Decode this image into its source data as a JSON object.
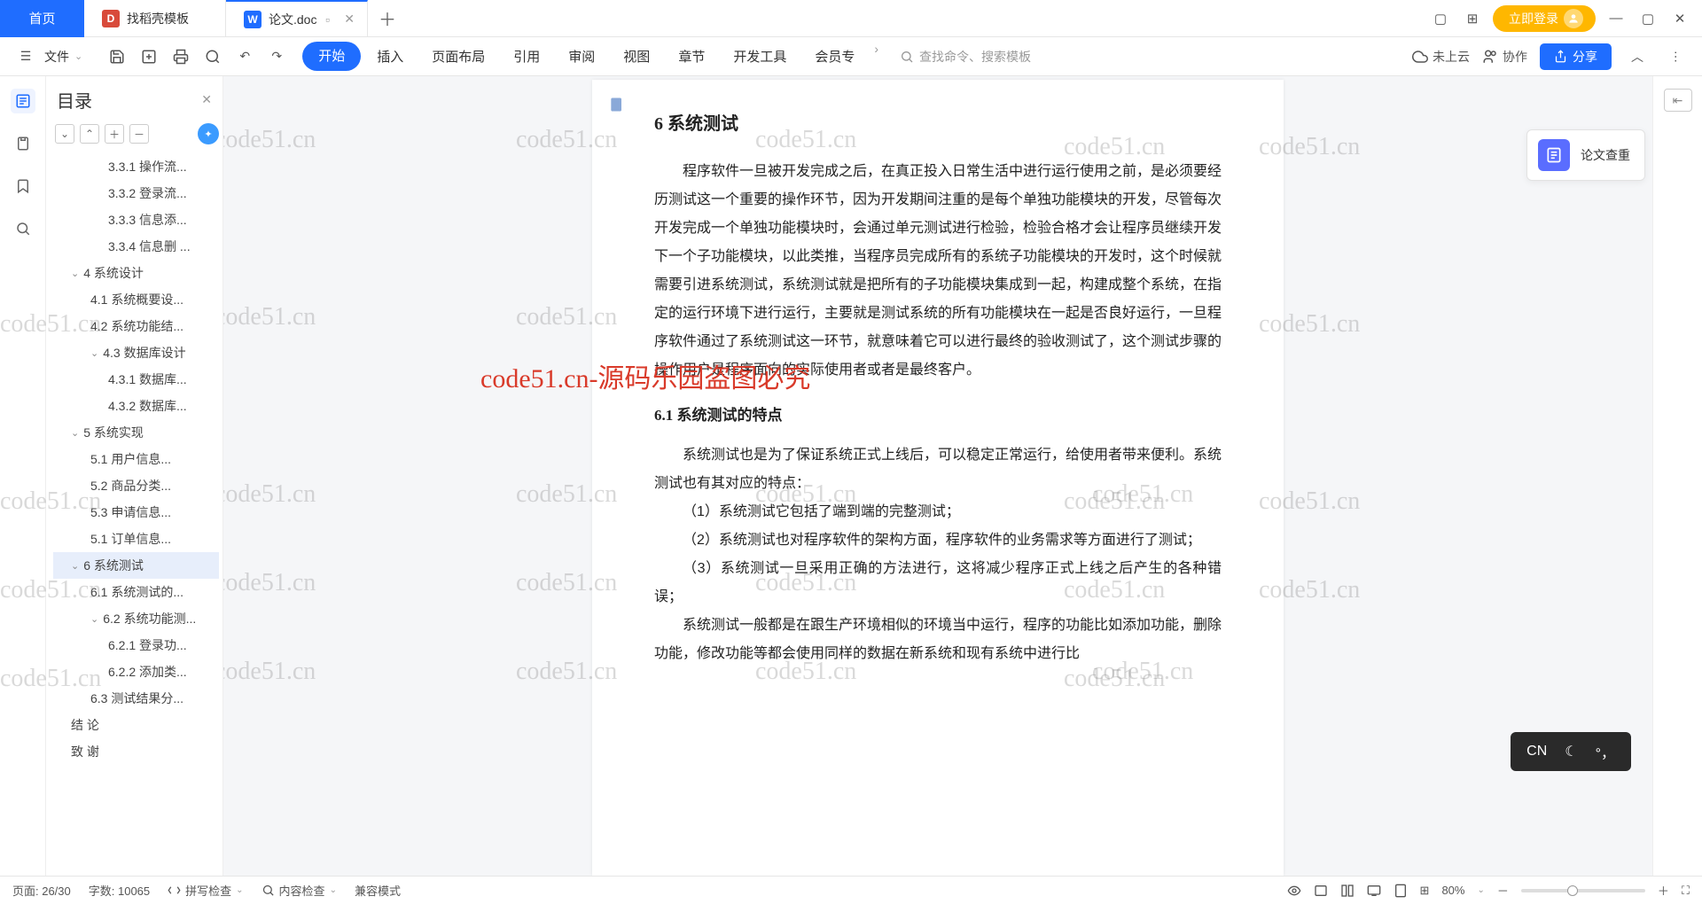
{
  "tabs": {
    "home": "首页",
    "t1": "找稻壳模板",
    "t2": "论文.doc",
    "add": "＋"
  },
  "login": "立即登录",
  "toolbar_menu": [
    "开始",
    "插入",
    "页面布局",
    "引用",
    "审阅",
    "视图",
    "章节",
    "开发工具",
    "会员专"
  ],
  "file_label": "文件",
  "search_placeholder": "查找命令、搜索模板",
  "cloud": "未上云",
  "collab": "协作",
  "share": "分享",
  "outline": {
    "title": "目录",
    "items": [
      {
        "t": "3.3.1  操作流...",
        "lv": 3
      },
      {
        "t": "3.3.2  登录流...",
        "lv": 3
      },
      {
        "t": "3.3.3  信息添...",
        "lv": 3
      },
      {
        "t": "3.3.4  信息删 ...",
        "lv": 3
      },
      {
        "t": "4  系统设计",
        "lv": 1,
        "c": 1
      },
      {
        "t": "4.1  系统概要设...",
        "lv": 2
      },
      {
        "t": "4.2  系统功能结...",
        "lv": 2
      },
      {
        "t": "4.3  数据库设计",
        "lv": 2,
        "c": 1
      },
      {
        "t": "4.3.1  数据库...",
        "lv": 3
      },
      {
        "t": "4.3.2  数据库...",
        "lv": 3
      },
      {
        "t": "5  系统实现",
        "lv": 1,
        "c": 1
      },
      {
        "t": "5.1 用户信息...",
        "lv": 2
      },
      {
        "t": "5.2  商品分类...",
        "lv": 2
      },
      {
        "t": "5.3  申请信息...",
        "lv": 2
      },
      {
        "t": "5.1 订单信息...",
        "lv": 2
      },
      {
        "t": "6  系统测试",
        "lv": 1,
        "c": 1,
        "sel": 1
      },
      {
        "t": "6.1  系统测试的...",
        "lv": 2
      },
      {
        "t": "6.2  系统功能测...",
        "lv": 2,
        "c": 1
      },
      {
        "t": "6.2.1  登录功...",
        "lv": 3
      },
      {
        "t": "6.2.2  添加类...",
        "lv": 3
      },
      {
        "t": "6.3  测试结果分...",
        "lv": 2
      },
      {
        "t": "结    论",
        "lv": 1
      },
      {
        "t": "致    谢",
        "lv": 1
      }
    ]
  },
  "doc": {
    "h2": "6  系统测试",
    "p1": "程序软件一旦被开发完成之后，在真正投入日常生活中进行运行使用之前，是必须要经历测试这一个重要的操作环节，因为开发期间注重的是每个单独功能模块的开发，尽管每次开发完成一个单独功能模块时，会通过单元测试进行检验，检验合格才会让程序员继续开发下一个子功能模块，以此类推，当程序员完成所有的系统子功能模块的开发时，这个时候就需要引进系统测试，系统测试就是把所有的子功能模块集成到一起，构建成整个系统，在指定的运行环境下进行运行，主要就是测试系统的所有功能模块在一起是否良好运行，一旦程序软件通过了系统测试这一环节，就意味着它可以进行最终的验收测试了，这个测试步骤的操作用户是程序面向的实际使用者或者是最终客户。",
    "h3": "6.1  系统测试的特点",
    "p2": "系统测试也是为了保证系统正式上线后，可以稳定正常运行，给使用者带来便利。系统测试也有其对应的特点：",
    "li1": "（1）系统测试它包括了端到端的完整测试；",
    "li2": "（2）系统测试也对程序软件的架构方面，程序软件的业务需求等方面进行了测试；",
    "li3": "（3）系统测试一旦采用正确的方法进行，这将减少程序正式上线之后产生的各种错误；",
    "p3": "系统测试一般都是在跟生产环境相似的环境当中运行，程序的功能比如添加功能，删除功能，修改功能等都会使用同样的数据在新系统和现有系统中进行比"
  },
  "plag": "论文查重",
  "wm_main": "code51.cn-源码乐园盗图必究",
  "wm_grey": "code51.cn",
  "status": {
    "page": "页面: 26/30",
    "words": "字数: 10065",
    "spell": "拼写检查",
    "content": "内容检查",
    "compat": "兼容模式",
    "zoom": "80%"
  },
  "ime": "CN"
}
